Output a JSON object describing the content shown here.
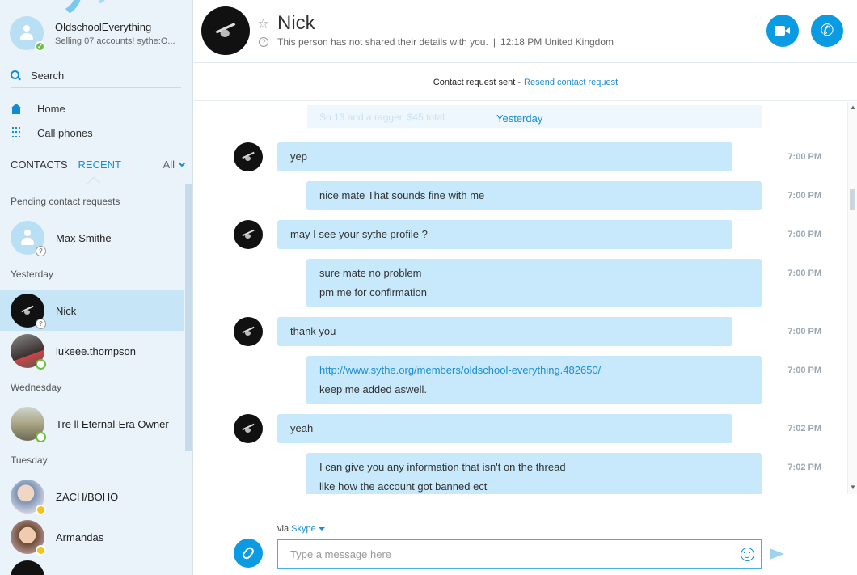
{
  "me": {
    "name": "OldschoolEverything",
    "mood": "Selling 07 accounts! sythe:O..."
  },
  "search": {
    "label": "Search"
  },
  "nav": {
    "home": "Home",
    "call_phones": "Call phones"
  },
  "tabs": {
    "contacts": "CONTACTS",
    "recent": "RECENT",
    "filter": "All"
  },
  "sidebar": {
    "sections": {
      "pending": "Pending contact requests",
      "yesterday": "Yesterday",
      "wednesday": "Wednesday",
      "tuesday": "Tuesday"
    },
    "contacts": [
      {
        "name": "Max Smithe",
        "status": "pending"
      },
      {
        "name": "Nick",
        "status": "pending",
        "selected": true
      },
      {
        "name": "lukeee.thompson",
        "status": "online"
      },
      {
        "name": "Tre ll Eternal-Era Owner",
        "status": "online"
      },
      {
        "name": "ZACH/BOHO",
        "status": "away"
      },
      {
        "name": "Armandas",
        "status": "away"
      }
    ]
  },
  "header": {
    "name": "Nick",
    "details": "This person has not shared their details with you.",
    "separator": "|",
    "time_location": "12:18 PM United Kingdom"
  },
  "request_bar": {
    "text": "Contact request sent -",
    "link": "Resend contact request"
  },
  "chat": {
    "ghost_text": "So 13 and a ragger, $45 total",
    "day_header": "Yesterday",
    "messages": [
      {
        "dir": "in",
        "lines": [
          "yep"
        ],
        "time": "7:00 PM"
      },
      {
        "dir": "out",
        "lines": [
          "nice mate That sounds fine with me"
        ],
        "time": "7:00 PM"
      },
      {
        "dir": "in",
        "lines": [
          "may I see your sythe profile ?"
        ],
        "time": "7:00 PM"
      },
      {
        "dir": "out",
        "lines": [
          "sure mate no problem",
          "pm me for confirmation"
        ],
        "time": "7:00 PM"
      },
      {
        "dir": "in",
        "lines": [
          "thank you"
        ],
        "time": "7:00 PM"
      },
      {
        "dir": "out",
        "link": "http://www.sythe.org/members/oldschool-everything.482650/",
        "lines": [
          "keep me added aswell."
        ],
        "time": "7:00 PM"
      },
      {
        "dir": "in",
        "lines": [
          "yeah"
        ],
        "time": "7:02 PM"
      },
      {
        "dir": "out",
        "lines": [
          "I can give you any information that isn't on the thread",
          "like how the account got banned ect"
        ],
        "time": "7:02 PM"
      }
    ]
  },
  "composer": {
    "via_label": "via",
    "via_service": "Skype",
    "placeholder": "Type a message here"
  },
  "colors": {
    "accent": "#0a9be3",
    "bubble": "#c7e9fb",
    "sidebar_bg": "#eaf3fa",
    "selected": "#c6e6f8"
  }
}
